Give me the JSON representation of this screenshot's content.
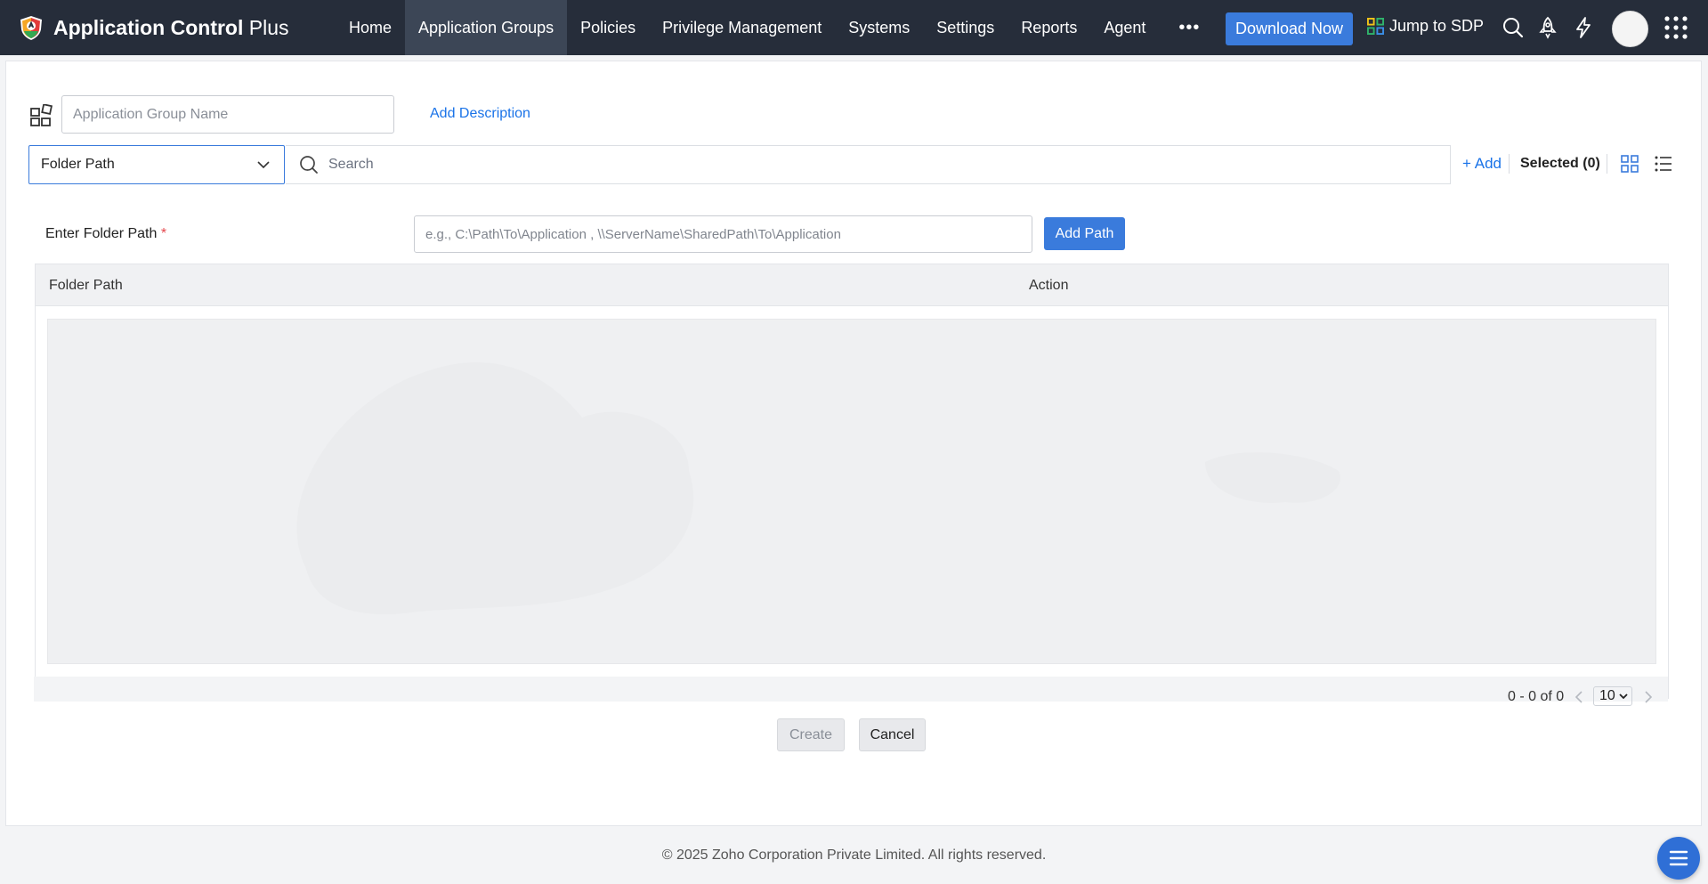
{
  "app": {
    "brand_bold": "Application Control",
    "brand_light": "Plus"
  },
  "nav": {
    "items": [
      {
        "label": "Home"
      },
      {
        "label": "Application Groups",
        "active": true
      },
      {
        "label": "Policies"
      },
      {
        "label": "Privilege Management"
      },
      {
        "label": "Systems"
      },
      {
        "label": "Settings"
      },
      {
        "label": "Reports"
      },
      {
        "label": "Agent"
      }
    ],
    "more_label": "•••",
    "download_label": "Download Now",
    "jump_label": "Jump to SDP",
    "icons": [
      "search-icon",
      "rocket-icon",
      "lightning-icon",
      "avatar",
      "apps-grid-icon"
    ]
  },
  "form": {
    "group_name_placeholder": "Application Group Name",
    "add_description": "Add Description",
    "filter_selected": "Folder Path",
    "search_placeholder": "Search",
    "add_label": "Add",
    "selected_label": "Selected (0)",
    "folder_path_label": "Enter Folder Path",
    "required_mark": "*",
    "folder_path_placeholder": "e.g., C:\\Path\\To\\Application , \\\\ServerName\\SharedPath\\To\\Application",
    "add_path_button": "Add Path"
  },
  "table": {
    "columns": [
      "Folder Path",
      "Action"
    ],
    "rows": []
  },
  "pagination": {
    "range_text": "0 - 0 of 0",
    "page_size": "10"
  },
  "actions": {
    "create": "Create",
    "cancel": "Cancel"
  },
  "footer": {
    "copyright": "© 2025 Zoho Corporation Private Limited. All rights reserved."
  },
  "colors": {
    "topbar": "#262d3a",
    "accent": "#3a7bdc",
    "link": "#1a73e8"
  }
}
